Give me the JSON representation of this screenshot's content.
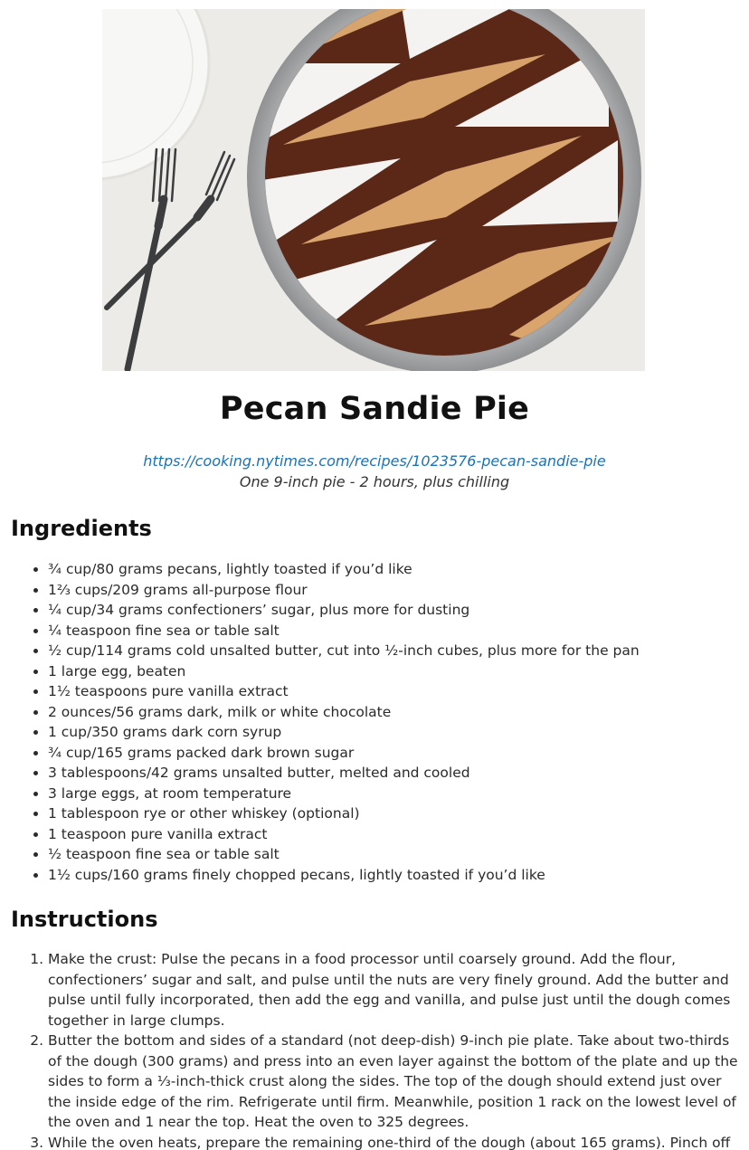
{
  "recipe": {
    "title": "Pecan Sandie Pie",
    "source_url": "https://cooking.nytimes.com/recipes/1023576-pecan-sandie-pie",
    "yield": "One 9-inch pie - 2 hours, plus chilling"
  },
  "hero_image": {
    "description_icon": "pecan-pie-photo",
    "colors": {
      "background": "#ececea",
      "plate": "#a9abad",
      "filling": "#5a2a1a",
      "cookie": "#d9a36b",
      "sugar": "#f5f5f5"
    }
  },
  "sections": {
    "ingredients_heading": "Ingredients",
    "instructions_heading": "Instructions"
  },
  "ingredients": [
    "¾ cup/80 grams pecans, lightly toasted if you’d like",
    "1⅔ cups/209 grams all-purpose flour",
    "¼ cup/34 grams confectioners’ sugar, plus more for dusting",
    "¼ teaspoon fine sea or table salt",
    "½ cup/114 grams cold unsalted butter, cut into ½-inch cubes, plus more for the pan",
    "1 large egg, beaten",
    "1½ teaspoons pure vanilla extract",
    "2 ounces/56 grams dark, milk or white chocolate",
    "1 cup/350 grams dark corn syrup",
    "¾ cup/165 grams packed dark brown sugar",
    "3 tablespoons/42 grams unsalted butter, melted and cooled",
    "3 large eggs, at room temperature",
    "1 tablespoon rye or other whiskey (optional)",
    "1 teaspoon pure vanilla extract",
    "½ teaspoon fine sea or table salt",
    "1½ cups/160 grams finely chopped pecans, lightly toasted if you’d like"
  ],
  "instructions": [
    "Make the crust: Pulse the pecans in a food processor until coarsely ground. Add the flour, confectioners’ sugar and salt, and pulse until the nuts are very finely ground. Add the butter and pulse until fully incorporated, then add the egg and vanilla, and pulse just until the dough comes together in large clumps.",
    "Butter the bottom and sides of a standard (not deep-dish) 9-inch pie plate. Take about two-thirds of the dough (300 grams) and press into an even layer against the bottom of the plate and up the sides to form a ⅓-inch-thick crust along the sides. The top of the dough should extend just over the inside edge of the rim. Refrigerate until firm. Meanwhile, position 1 rack on the lowest level of the oven and 1 near the top. Heat the oven to 325 degrees.",
    "While the oven heats, prepare the remaining one-third of the dough (about 165 grams). Pinch off a"
  ]
}
